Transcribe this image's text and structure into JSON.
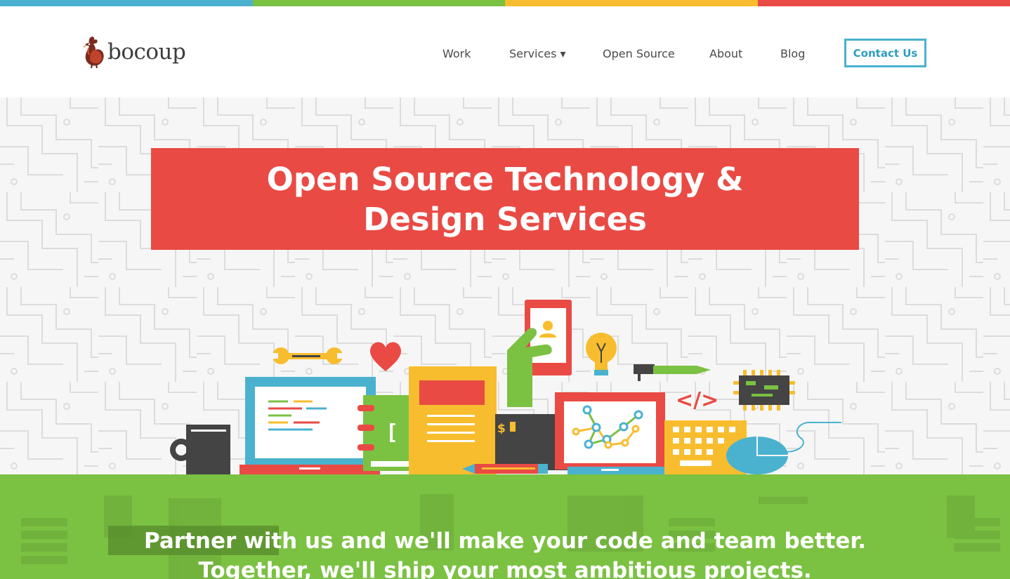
{
  "colors": {
    "strip": [
      "#4ab2cf",
      "#7bc142",
      "#f8bd2e",
      "#ea4a44"
    ],
    "accent_red": "#ea4a44",
    "accent_green": "#7bc142",
    "accent_blue": "#4ab2cf"
  },
  "brand": {
    "name": "bocoup",
    "logo_icon": "rooster-icon"
  },
  "nav": {
    "items": [
      {
        "label": "Work"
      },
      {
        "label": "Services ▾"
      },
      {
        "label": "Open Source"
      },
      {
        "label": "About"
      },
      {
        "label": "Blog"
      }
    ],
    "cta_label": "Contact Us"
  },
  "hero": {
    "title": "Open Source Technology & Design Services",
    "illustration_icons": [
      "wrench-icon",
      "heart-icon",
      "laptop-icon",
      "mug-icon",
      "notebook-icon",
      "document-icon",
      "phone-icon",
      "lightbulb-icon",
      "pen-icon",
      "code-icon",
      "chip-icon",
      "monitor-chart-icon",
      "keyboard-icon",
      "mouse-icon",
      "wallet-icon",
      "pencil-icon"
    ]
  },
  "band": {
    "text": "Partner with us and we'll make your code and team better. Together, we'll ship your most ambitious projects."
  }
}
